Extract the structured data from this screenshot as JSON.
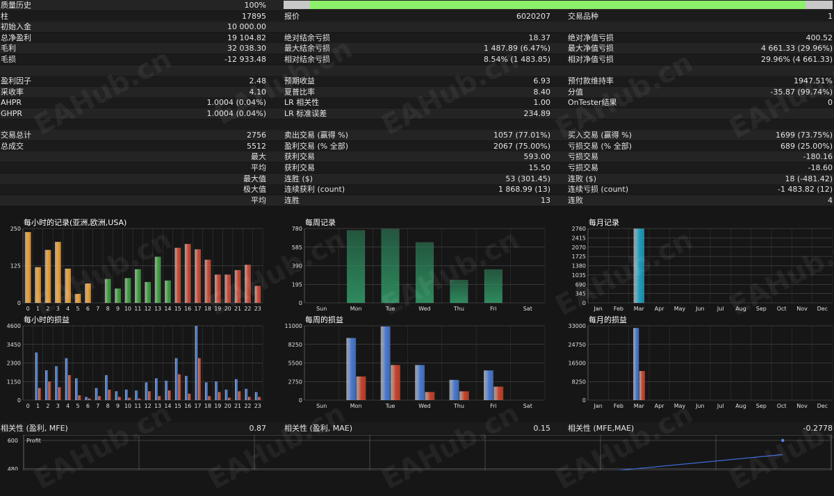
{
  "rows": [
    {
      "cells": [
        {
          "label": "质量历史",
          "value": "100%"
        }
      ],
      "progress": 0.95
    },
    {
      "cells": [
        {
          "label": "柱",
          "value": "17895"
        },
        {
          "label": "报价",
          "value": "6020207"
        },
        {
          "label": "交易品种",
          "value": "1"
        }
      ]
    },
    {
      "cells": [
        {
          "label": "初始入金",
          "value": "10 000.00"
        }
      ]
    },
    {
      "cells": [
        {
          "label": "总净盈利",
          "value": "19 104.82"
        },
        {
          "label": "绝对结余亏损",
          "value": "18.37"
        },
        {
          "label": "绝对净值亏损",
          "value": "400.52"
        }
      ]
    },
    {
      "cells": [
        {
          "label": "毛利",
          "value": "32 038.30"
        },
        {
          "label": "最大结余亏损",
          "value": "1 487.89 (6.47%)"
        },
        {
          "label": "最大净值亏损",
          "value": "4 661.33 (29.96%)"
        }
      ]
    },
    {
      "cells": [
        {
          "label": "毛损",
          "value": "-12 933.48"
        },
        {
          "label": "相对结余亏损",
          "value": "8.54% (1 483.85)"
        },
        {
          "label": "相对净值亏损",
          "value": "29.96% (4 661.33)"
        }
      ]
    },
    {
      "cells": []
    },
    {
      "cells": [
        {
          "label": "盈利因子",
          "value": "2.48"
        },
        {
          "label": "预期收益",
          "value": "6.93"
        },
        {
          "label": "预付款维持率",
          "value": "1947.51%"
        }
      ]
    },
    {
      "cells": [
        {
          "label": "采收率",
          "value": "4.10"
        },
        {
          "label": "夏普比率",
          "value": "8.40"
        },
        {
          "label": "分值",
          "value": "-35.87 (99.74%)"
        }
      ]
    },
    {
      "cells": [
        {
          "label": "AHPR",
          "value": "1.0004 (0.04%)"
        },
        {
          "label": "LR 相关性",
          "value": "1.00"
        },
        {
          "label": "OnTester结果",
          "value": "0"
        }
      ]
    },
    {
      "cells": [
        {
          "label": "GHPR",
          "value": "1.0004 (0.04%)"
        },
        {
          "label": "LR 标准误差",
          "value": "234.89"
        }
      ]
    },
    {
      "cells": []
    },
    {
      "cells": [
        {
          "label": "交易总计",
          "value": "2756"
        },
        {
          "label": "卖出交易 (赢得 %)",
          "value": "1057 (77.01%)"
        },
        {
          "label": "买入交易 (赢得 %)",
          "value": "1699 (73.75%)"
        }
      ]
    },
    {
      "cells": [
        {
          "label": "总成交",
          "value": "5512"
        },
        {
          "label": "盈利交易 (% 全部)",
          "value": "2067 (75.00%)"
        },
        {
          "label": "亏损交易 (% 全部)",
          "value": "689 (25.00%)"
        }
      ]
    },
    {
      "cells": [
        {
          "label": "",
          "value": "最大"
        },
        {
          "label": "获利交易",
          "value": "593.00"
        },
        {
          "label": "亏损交易",
          "value": "-180.16"
        }
      ]
    },
    {
      "cells": [
        {
          "label": "",
          "value": "平均"
        },
        {
          "label": "获利交易",
          "value": "15.50"
        },
        {
          "label": "亏损交易",
          "value": "-18.60"
        }
      ]
    },
    {
      "cells": [
        {
          "label": "",
          "value": "最大值"
        },
        {
          "label": "连胜 ($)",
          "value": "53 (301.45)"
        },
        {
          "label": "连败 ($)",
          "value": "18 (-481.42)"
        }
      ]
    },
    {
      "cells": [
        {
          "label": "",
          "value": "极大值"
        },
        {
          "label": "连续获利 (count)",
          "value": "1 868.99 (13)"
        },
        {
          "label": "连续亏损 (count)",
          "value": "-1 483.82 (12)"
        }
      ]
    },
    {
      "cells": [
        {
          "label": "",
          "value": "平均"
        },
        {
          "label": "连胜",
          "value": "13"
        },
        {
          "label": "连败",
          "value": "4"
        }
      ]
    }
  ],
  "correlation": [
    {
      "label": "相关性 (盈利, MFE)",
      "value": "0.87"
    },
    {
      "label": "相关性 (盈利, MAE)",
      "value": "0.15"
    },
    {
      "label": "相关性 (MFE,MAE)",
      "value": "-0.2778"
    }
  ],
  "watermark_text": "EAHub.cn",
  "colors": {
    "progress": "#8cf06a",
    "hour_asia": "#f0a030",
    "hour_europe": "#3ea33e",
    "hour_usa": "#d04b35",
    "week": "#2e8a5e",
    "month": "#1ea0c0",
    "profit": "#4a7ad0",
    "loss": "#c8452c",
    "line": "#3d6cd8"
  },
  "chart_data": [
    {
      "id": "hourly-records",
      "type": "bar",
      "title": "每小时的记录(亚洲,欧洲,USA)",
      "categories": [
        "0",
        "1",
        "2",
        "3",
        "4",
        "5",
        "6",
        "7",
        "8",
        "9",
        "10",
        "11",
        "12",
        "13",
        "14",
        "15",
        "16",
        "17",
        "18",
        "19",
        "20",
        "21",
        "22",
        "23"
      ],
      "values": [
        0,
        238,
        120,
        178,
        205,
        115,
        30,
        65,
        0,
        80,
        48,
        83,
        113,
        70,
        155,
        75,
        185,
        198,
        180,
        145,
        95,
        95,
        110,
        128,
        57
      ],
      "series": [
        {
          "values": [
            0,
            238,
            120,
            178,
            205,
            115,
            30,
            65,
            0,
            80,
            48,
            83,
            113,
            70,
            155,
            75,
            185,
            198,
            180,
            145,
            95,
            95,
            110,
            128,
            57
          ]
        }
      ],
      "yticks": [
        0,
        125,
        250
      ],
      "ylim": [
        0,
        250
      ]
    },
    {
      "id": "weekly-records",
      "type": "bar",
      "title": "每周记录",
      "categories": [
        "Sun",
        "Mon",
        "Tue",
        "Wed",
        "Thu",
        "Fri",
        "Sat"
      ],
      "values": [
        0,
        760,
        775,
        635,
        240,
        350,
        0
      ],
      "yticks": [
        0,
        195,
        390,
        585,
        780
      ],
      "ylim": [
        0,
        780
      ]
    },
    {
      "id": "monthly-records",
      "type": "bar",
      "title": "每月记录",
      "categories": [
        "Jan",
        "Feb",
        "Mar",
        "Apr",
        "May",
        "Jun",
        "Jul",
        "Aug",
        "Sep",
        "Oct",
        "Nov",
        "Dec"
      ],
      "values": [
        0,
        0,
        2756,
        0,
        0,
        0,
        0,
        0,
        0,
        0,
        0,
        0
      ],
      "yticks": [
        0,
        345,
        690,
        1035,
        1380,
        1725,
        2070,
        2415,
        2760
      ],
      "ylim": [
        0,
        2760
      ]
    },
    {
      "id": "hourly-pnl",
      "type": "bar",
      "title": "每小时的损益",
      "categories": [
        "0",
        "1",
        "2",
        "3",
        "4",
        "5",
        "6",
        "7",
        "8",
        "9",
        "10",
        "11",
        "12",
        "13",
        "14",
        "15",
        "16",
        "17",
        "18",
        "19",
        "20",
        "21",
        "22",
        "23"
      ],
      "series": [
        {
          "name": "profit",
          "values": [
            0,
            2950,
            1850,
            2100,
            2600,
            1350,
            200,
            750,
            1550,
            550,
            650,
            600,
            1100,
            1350,
            1200,
            2600,
            1500,
            4600,
            1100,
            1150,
            650,
            1300,
            700,
            500
          ]
        },
        {
          "name": "loss",
          "values": [
            0,
            750,
            1150,
            800,
            1550,
            300,
            100,
            250,
            650,
            200,
            150,
            100,
            550,
            250,
            600,
            1600,
            400,
            2600,
            250,
            500,
            150,
            550,
            200,
            200
          ]
        }
      ],
      "yticks": [
        0,
        1150,
        2300,
        3450,
        4600
      ],
      "ylim": [
        0,
        4600
      ]
    },
    {
      "id": "weekly-pnl",
      "type": "bar",
      "title": "每周的损益",
      "categories": [
        "Sun",
        "Mon",
        "Tue",
        "Wed",
        "Thu",
        "Fri",
        "Sat"
      ],
      "series": [
        {
          "name": "profit",
          "values": [
            0,
            9200,
            10900,
            5200,
            3000,
            4400,
            0
          ]
        },
        {
          "name": "loss",
          "values": [
            0,
            3500,
            5200,
            1200,
            1300,
            2000,
            0
          ]
        }
      ],
      "yticks": [
        0,
        2750,
        5500,
        8250,
        11000
      ],
      "ylim": [
        0,
        11000
      ]
    },
    {
      "id": "monthly-pnl",
      "type": "bar",
      "title": "每月的损益",
      "categories": [
        "Jan",
        "Feb",
        "Mar",
        "Apr",
        "May",
        "Jun",
        "Jul",
        "Aug",
        "Sep",
        "Oct",
        "Nov",
        "Dec"
      ],
      "series": [
        {
          "name": "profit",
          "values": [
            0,
            0,
            32038,
            0,
            0,
            0,
            0,
            0,
            0,
            0,
            0,
            0
          ]
        },
        {
          "name": "loss",
          "values": [
            0,
            0,
            12933,
            0,
            0,
            0,
            0,
            0,
            0,
            0,
            0,
            0
          ]
        }
      ],
      "yticks": [
        0,
        8250,
        16500,
        24750,
        33000
      ],
      "ylim": [
        0,
        33000
      ]
    },
    {
      "id": "mfe-scatter",
      "type": "scatter",
      "title": "Profit",
      "yticks": [
        360,
        480,
        600
      ],
      "points": [
        [
          0.39,
          346
        ],
        [
          0.42,
          350
        ],
        [
          0.455,
          355
        ],
        [
          0.475,
          360
        ],
        [
          0.5,
          366
        ],
        [
          0.515,
          368
        ],
        [
          0.52,
          364
        ],
        [
          0.565,
          380
        ],
        [
          0.59,
          385
        ],
        [
          0.65,
          395
        ],
        [
          0.69,
          405
        ],
        [
          0.71,
          410
        ],
        [
          0.73,
          415
        ],
        [
          0.74,
          425
        ],
        [
          0.94,
          600
        ]
      ]
    }
  ]
}
